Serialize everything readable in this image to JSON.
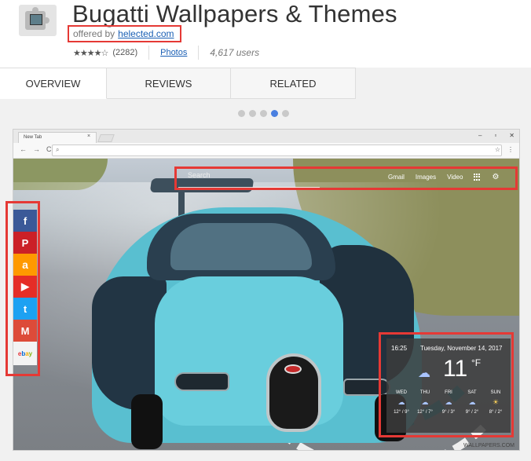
{
  "header": {
    "title": "Bugatti Wallpapers & Themes",
    "offered_by_label": "offered by",
    "offered_by_link": "helected.com",
    "stars": "★★★★☆",
    "rating_count": "(2282)",
    "category": "Photos",
    "users": "4,617 users"
  },
  "tabs": [
    {
      "label": "OVERVIEW",
      "active": true
    },
    {
      "label": "REVIEWS",
      "active": false
    },
    {
      "label": "RELATED",
      "active": false
    }
  ],
  "carousel": {
    "count": 5,
    "active_index": 3
  },
  "screenshot": {
    "browser": {
      "tab_title": "New Tab",
      "tab_close": "×",
      "window_controls": [
        "–",
        "▫",
        "✕"
      ],
      "nav": [
        "←",
        "→",
        "C"
      ],
      "star": "☆",
      "menu": "⋮"
    },
    "search_placeholder": "Search",
    "top_links": [
      "Gmail",
      "Images",
      "Video"
    ],
    "weather": {
      "time": "16:25",
      "date": "Tuesday, November 14, 2017",
      "temp": "11",
      "unit": "°F",
      "days": [
        {
          "day": "WED",
          "temps": "12° / 9°",
          "icon": "cloud-icon"
        },
        {
          "day": "THU",
          "temps": "12° / 7°",
          "icon": "cloud-icon"
        },
        {
          "day": "FRI",
          "temps": "9° / 3°",
          "icon": "cloud-icon"
        },
        {
          "day": "SAT",
          "temps": "9° / 2°",
          "icon": "cloud-icon"
        },
        {
          "day": "SUN",
          "temps": "8° / 2°",
          "icon": "sun-cloud-icon"
        }
      ]
    },
    "watermark": "WALLPAPERS.COM"
  },
  "social": [
    {
      "name": "facebook",
      "glyph": "f"
    },
    {
      "name": "pinterest",
      "glyph": "P"
    },
    {
      "name": "amazon",
      "glyph": "a"
    },
    {
      "name": "youtube",
      "glyph": "▶"
    },
    {
      "name": "twitter",
      "glyph": "t"
    },
    {
      "name": "gmail",
      "glyph": "M"
    },
    {
      "name": "ebay",
      "glyph": "ebay"
    }
  ],
  "colors": {
    "highlight": "#e53935",
    "link": "#1a5fb4",
    "carousel_active": "#4a80e0"
  }
}
